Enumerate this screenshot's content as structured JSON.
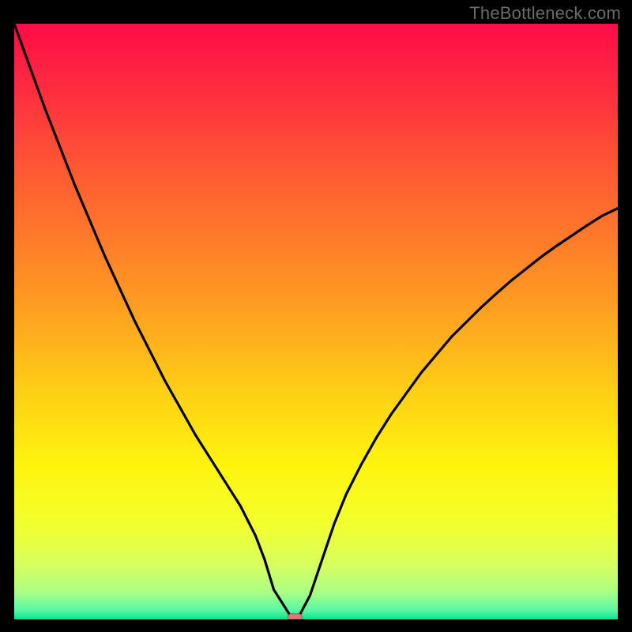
{
  "watermark": "TheBottleneck.com",
  "chart_data": {
    "type": "line",
    "title": "",
    "xlabel": "",
    "ylabel": "",
    "xlim": [
      0,
      100
    ],
    "ylim": [
      0,
      100
    ],
    "x": [
      0,
      2.5,
      5,
      7.5,
      10,
      12.5,
      15,
      17.5,
      20,
      22.5,
      25,
      27.5,
      30,
      32.5,
      35,
      37.5,
      40,
      41.5,
      43,
      46,
      47,
      49,
      51,
      53,
      55,
      57.5,
      60,
      62.5,
      65,
      67.5,
      70,
      72.5,
      75,
      77.5,
      80,
      82.5,
      85,
      87.5,
      90,
      92.5,
      95,
      97.5,
      100
    ],
    "values": [
      100,
      93,
      86,
      79.5,
      73,
      67,
      61,
      55.5,
      50,
      45,
      40,
      35.5,
      31,
      27,
      23,
      19,
      14,
      10,
      5,
      0.2,
      0.2,
      4,
      10,
      16,
      21,
      26,
      30.5,
      34.5,
      38,
      41.5,
      44.5,
      47.5,
      50,
      52.5,
      54.8,
      57,
      59,
      61,
      62.8,
      64.5,
      66.2,
      67.8,
      69
    ],
    "marker": {
      "x": 46.5,
      "y": 0.3
    },
    "gradient_stops": [
      {
        "offset": 0.0,
        "color": "#ff0c47"
      },
      {
        "offset": 0.12,
        "color": "#ff2f3f"
      },
      {
        "offset": 0.25,
        "color": "#ff5a33"
      },
      {
        "offset": 0.38,
        "color": "#ff8028"
      },
      {
        "offset": 0.5,
        "color": "#ffa61f"
      },
      {
        "offset": 0.62,
        "color": "#ffd015"
      },
      {
        "offset": 0.74,
        "color": "#fff40e"
      },
      {
        "offset": 0.84,
        "color": "#f3ff2e"
      },
      {
        "offset": 0.91,
        "color": "#d6ff60"
      },
      {
        "offset": 0.955,
        "color": "#a9ff85"
      },
      {
        "offset": 0.985,
        "color": "#56f7a6"
      },
      {
        "offset": 1.0,
        "color": "#04e38f"
      }
    ],
    "colors": {
      "curve": "#000000",
      "marker_fill": "#d97a72",
      "marker_stroke": "#b95a54",
      "background_outer": "#000000"
    }
  }
}
